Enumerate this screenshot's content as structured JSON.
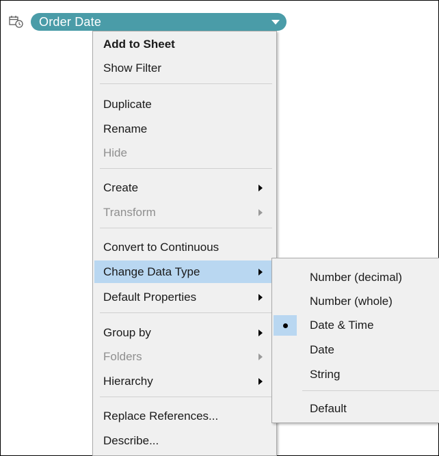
{
  "pill": {
    "icon": "date-calc-field-icon",
    "label": "Order Date",
    "bg_color": "#4a9ca8"
  },
  "menu": {
    "items": [
      {
        "label": "Add to Sheet",
        "bold": true
      },
      {
        "label": "Show Filter"
      },
      {
        "label": "Duplicate"
      },
      {
        "label": "Rename"
      },
      {
        "label": "Hide",
        "disabled": true
      },
      {
        "label": "Create",
        "submenu": true
      },
      {
        "label": "Transform",
        "submenu": true,
        "disabled": true
      },
      {
        "label": "Convert to Continuous"
      },
      {
        "label": "Change Data Type",
        "submenu": true,
        "highlighted": true
      },
      {
        "label": "Default Properties",
        "submenu": true
      },
      {
        "label": "Group by",
        "submenu": true
      },
      {
        "label": "Folders",
        "submenu": true,
        "disabled": true
      },
      {
        "label": "Hierarchy",
        "submenu": true
      },
      {
        "label": "Replace References..."
      },
      {
        "label": "Describe..."
      }
    ],
    "highlight_color": "#b9d7f1"
  },
  "submenu": {
    "items": [
      {
        "label": "Number (decimal)"
      },
      {
        "label": "Number (whole)"
      },
      {
        "label": "Date & Time",
        "checked": true
      },
      {
        "label": "Date"
      },
      {
        "label": "String"
      },
      {
        "label": "Default"
      }
    ]
  }
}
